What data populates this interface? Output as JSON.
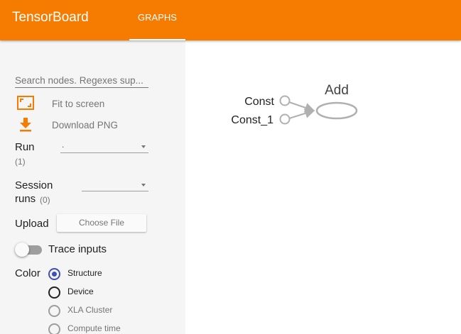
{
  "header": {
    "title": "TensorBoard",
    "tabs": [
      {
        "label": "GRAPHS",
        "active": true
      }
    ]
  },
  "sidebar": {
    "search": {
      "placeholder": "Search nodes. Regexes sup..."
    },
    "actions": [
      {
        "label": "Fit to screen",
        "icon": "fit-to-screen-icon"
      },
      {
        "label": "Download PNG",
        "icon": "download-icon"
      }
    ],
    "run": {
      "label": "Run",
      "count": "(1)",
      "value": "."
    },
    "session_runs": {
      "label_line1": "Session",
      "label_line2": "runs",
      "count": "(0)",
      "value": ""
    },
    "upload": {
      "label": "Upload",
      "button": "Choose File"
    },
    "trace_inputs": {
      "label": "Trace inputs",
      "enabled": false
    },
    "color": {
      "label": "Color",
      "options": [
        {
          "label": "Structure",
          "checked": true,
          "disabled": false
        },
        {
          "label": "Device",
          "checked": false,
          "disabled": false
        },
        {
          "label": "XLA Cluster",
          "checked": false,
          "disabled": true
        },
        {
          "label": "Compute time",
          "checked": false,
          "disabled": true
        }
      ]
    }
  },
  "graph": {
    "nodes": {
      "const": "Const",
      "const1": "Const_1",
      "add": "Add"
    }
  },
  "colors": {
    "header": "#f57c00",
    "sidebar": "#f5f5f5",
    "accent": "#3f51b5",
    "node_stroke": "#b0b0b0"
  }
}
